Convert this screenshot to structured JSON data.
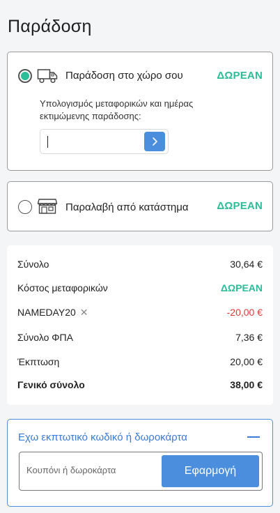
{
  "page": {
    "title": "Παράδοση"
  },
  "delivery": {
    "home": {
      "label": "Παράδοση στο χώρο σου",
      "price": "ΔΩΡΕΑΝ",
      "selected": true,
      "icon": "truck-icon",
      "calc_text": "Υπολογισμός μεταφορικών και ημέρας εκτιμώμενης παράδοσης:",
      "zip_value": "",
      "submit_icon": "chevron-right-icon"
    },
    "store": {
      "label": "Παραλαβή από κατάστημα",
      "price": "ΔΩΡΕΑΝ",
      "selected": false,
      "icon": "store-icon"
    }
  },
  "summary": {
    "rows": [
      {
        "label": "Σύνολο",
        "value": "30,64 €"
      },
      {
        "label": "Κόστος μεταφορικών",
        "value": "ΔΩΡΕΑΝ"
      },
      {
        "label": "NAMEDAY20",
        "value": "-20,00 €",
        "remove_icon": "close-icon"
      },
      {
        "label": "Σύνολο ΦΠΑ",
        "value": "7,36 €"
      },
      {
        "label": "Έκπτωση",
        "value": "20,00 €"
      },
      {
        "label": "Γενικό σύνολο",
        "value": "38,00 €"
      }
    ]
  },
  "coupon": {
    "title": "Εχω εκπτωτικό κωδικό ή δωροκάρτα",
    "collapse_icon": "minus-icon",
    "placeholder": "Κουπόνι ή δωροκάρτα",
    "button_label": "Εφαρμογή"
  },
  "colors": {
    "accent_green": "#2bbd97",
    "accent_blue": "#4c8ede",
    "discount_red": "#e53935"
  }
}
